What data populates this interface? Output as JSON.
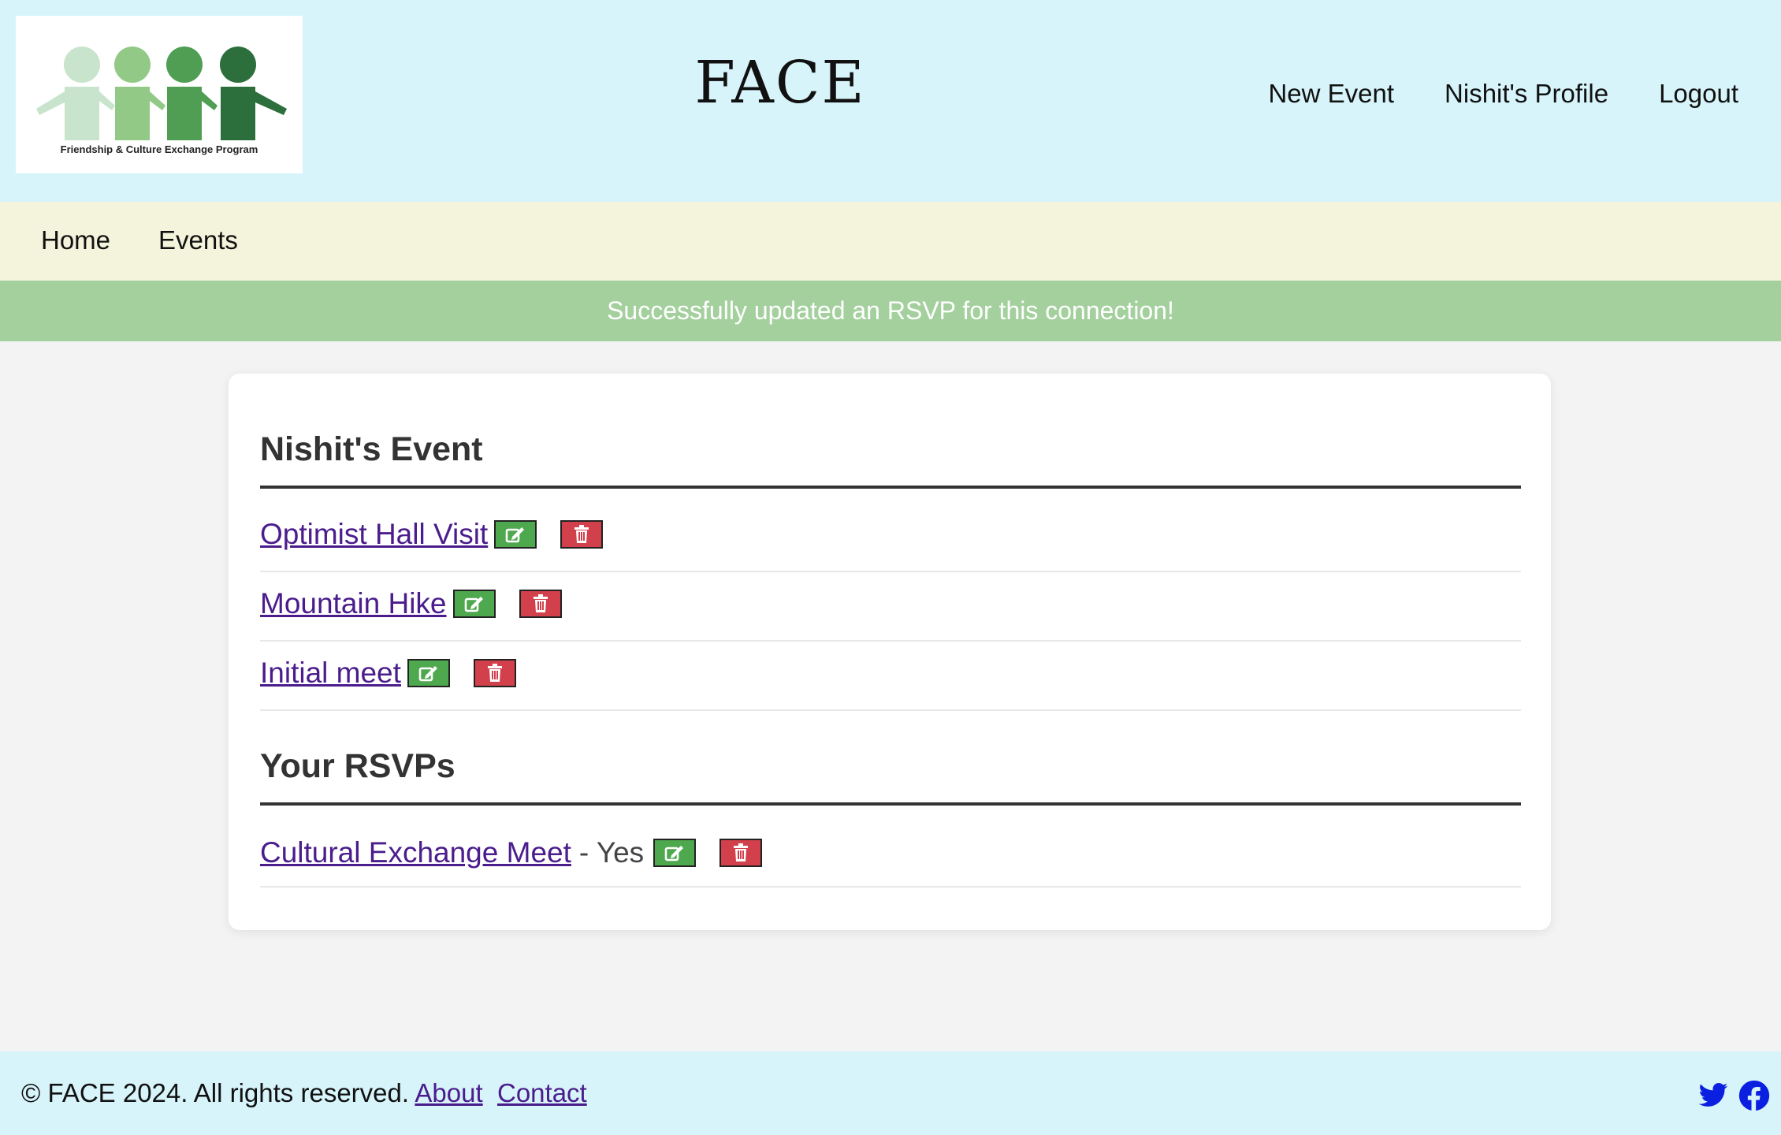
{
  "header": {
    "logo_caption": "Friendship & Culture Exchange Program",
    "site_title": "FACE",
    "nav": [
      {
        "label": "New Event"
      },
      {
        "label": "Nishit's Profile"
      },
      {
        "label": "Logout"
      }
    ]
  },
  "subnav": {
    "items": [
      {
        "label": "Home"
      },
      {
        "label": "Events"
      }
    ]
  },
  "flash": {
    "message": "Successfully updated an RSVP for this connection!"
  },
  "main": {
    "events_title": "Nishit's Event",
    "events": [
      {
        "title": "Optimist Hall Visit"
      },
      {
        "title": "Mountain Hike"
      },
      {
        "title": "Initial meet"
      }
    ],
    "rsvps_title": "Your RSVPs",
    "rsvps": [
      {
        "title": "Cultural Exchange Meet",
        "status": "- Yes"
      }
    ]
  },
  "footer": {
    "copyright": "© FACE 2024. All rights reserved.",
    "about_label": "About",
    "contact_label": "Contact",
    "social": [
      "twitter-icon",
      "facebook-icon"
    ]
  },
  "colors": {
    "header_bg": "#d6f4fa",
    "subnav_bg": "#f4f4dc",
    "flash_bg": "#a3d09d",
    "edit_button": "#4ea84d",
    "delete_button": "#d2414b",
    "link": "#4b1c8c"
  }
}
